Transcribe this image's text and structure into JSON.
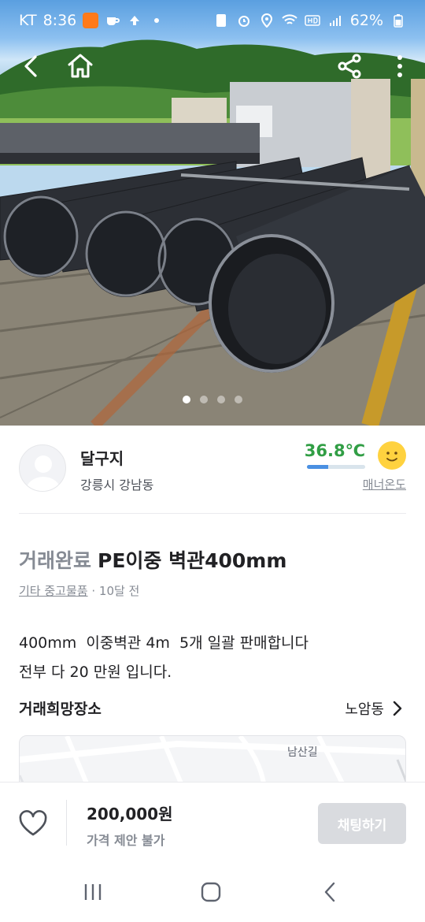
{
  "status_bar": {
    "carrier": "KT",
    "time": "8:36",
    "battery": "62%"
  },
  "photo": {
    "pages": 4,
    "current_page": 1
  },
  "icons": {
    "back": "back-arrow-icon",
    "home": "home-icon",
    "share": "share-icon",
    "more": "more-vertical-icon"
  },
  "seller": {
    "name": "달구지",
    "location": "강릉시 강남동",
    "temperature": "36.8℃",
    "temperature_level": 0.37,
    "manner_label": "매너온도",
    "accent": "#319e45"
  },
  "listing": {
    "status": "거래완료",
    "title": "PE이중 벽관400mm",
    "category": "기타 중고물품",
    "posted": "· 10달 전",
    "description": "400mm  이중벽관 4m  5개 일괄 판매합니다\n전부 다 20 만원 입니다."
  },
  "place": {
    "label": "거래희망장소",
    "value": "노암동",
    "map_label": "남산길"
  },
  "bottom": {
    "price": "200,000원",
    "negotiation": "가격 제안 불가",
    "chat_button": "채팅하기"
  }
}
